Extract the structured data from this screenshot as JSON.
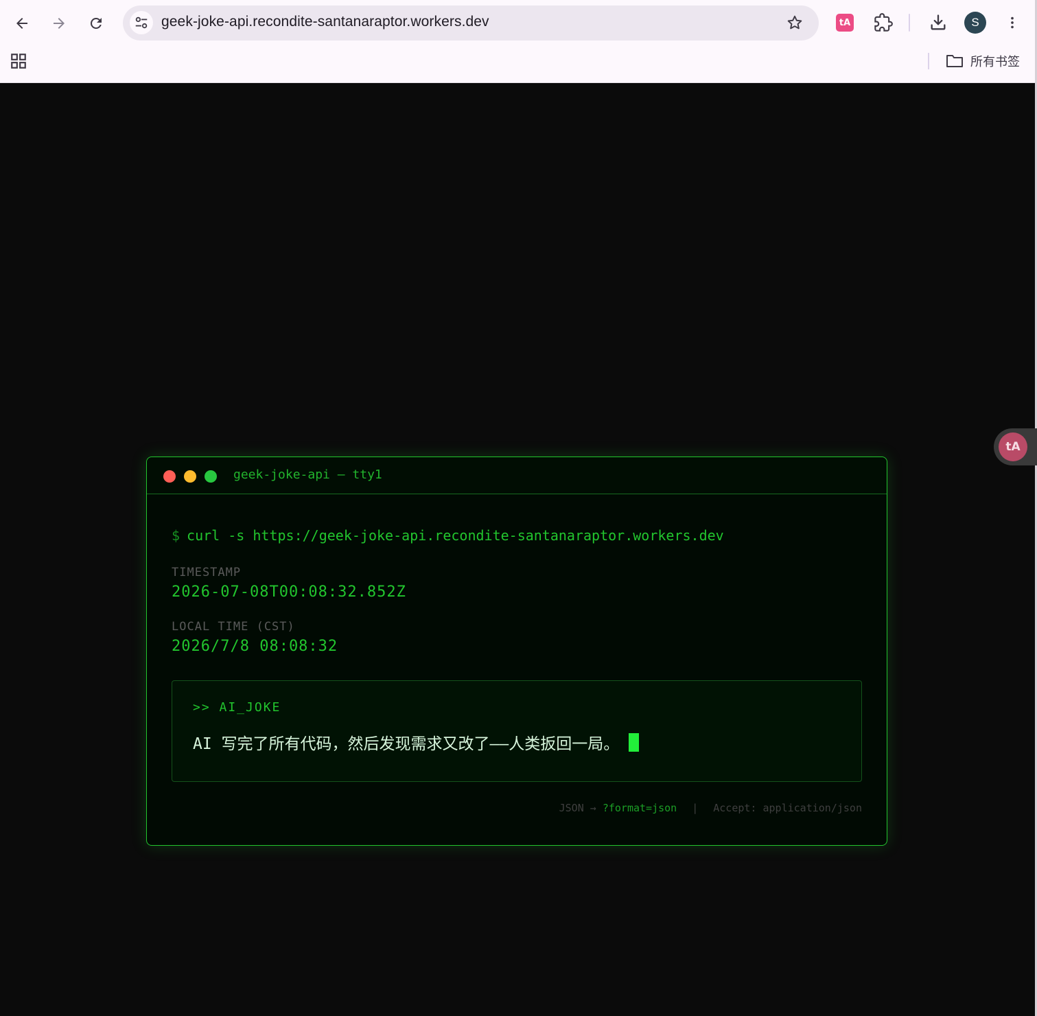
{
  "browser": {
    "url": "geek-joke-api.recondite-santanaraptor.workers.dev",
    "profile_initial": "S",
    "translate_ext_label": "tA",
    "bookmarks_all": "所有书签"
  },
  "terminal": {
    "title": "geek-joke-api — tty1",
    "prompt": "$",
    "command": "curl -s https://geek-joke-api.recondite-santanaraptor.workers.dev",
    "timestamp_label": "TIMESTAMP",
    "timestamp_value": "2026-07-08T00:08:32.852Z",
    "local_label": "LOCAL TIME (CST)",
    "local_value": "2026/7/8 08:08:32",
    "joke_header": ">> AI_JOKE",
    "joke_text": "AI 写完了所有代码，然后发现需求又改了——人类扳回一局。",
    "footer": {
      "json_label": "JSON →",
      "json_param": "?format=json",
      "separator": "|",
      "accept": "Accept: application/json"
    }
  },
  "colors": {
    "accent_green": "#22c52e",
    "dot_red": "#ff5f57",
    "dot_yellow": "#febc2e",
    "dot_green": "#28c840",
    "background": "#0b0b0b"
  }
}
